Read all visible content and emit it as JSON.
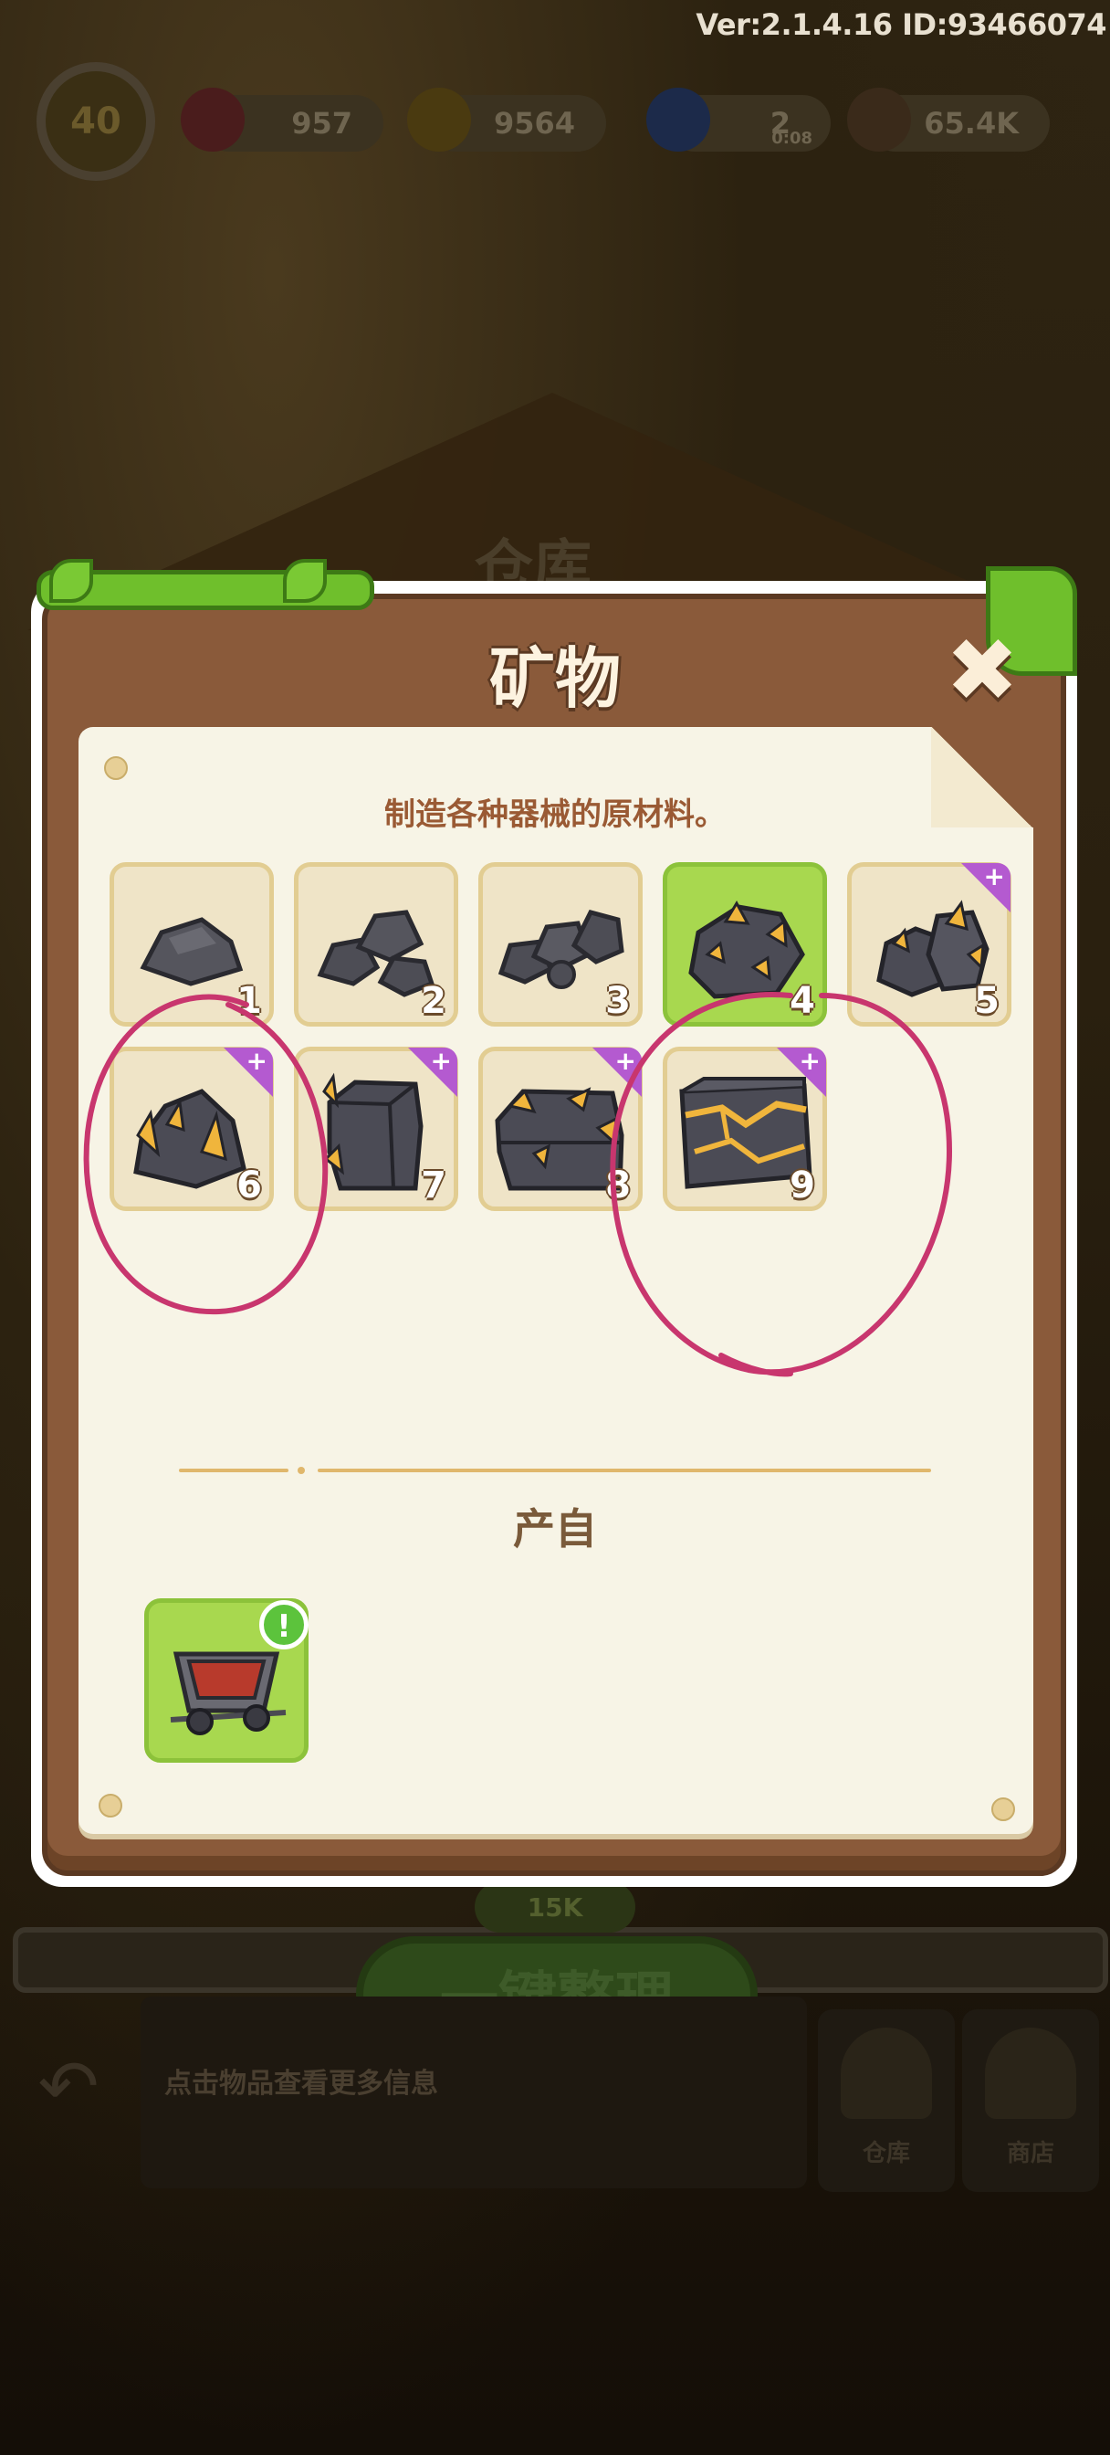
{
  "header": {
    "version": "Ver:2.1.4.16 ID:93466074",
    "level": "40",
    "gems": "957",
    "coins": "9564",
    "energy": "2",
    "energy_timer": "0:08",
    "seeds": "65.4K"
  },
  "background": {
    "warehouse_title": "仓库",
    "coin_cost": "15K",
    "sort_button": "一键整理",
    "hint": "点击物品查看更多信息",
    "nav_warehouse": "仓库",
    "nav_shop": "商店"
  },
  "modal": {
    "title": "矿物",
    "close_icon": "close-icon",
    "subtitle": "制造各种器械的原材料。",
    "items": [
      {
        "level": "1",
        "selected": false,
        "plus": false,
        "icon": "rock-icon"
      },
      {
        "level": "2",
        "selected": false,
        "plus": false,
        "icon": "rock-pile-icon"
      },
      {
        "level": "3",
        "selected": false,
        "plus": false,
        "icon": "rock-cluster-icon"
      },
      {
        "level": "4",
        "selected": true,
        "plus": false,
        "icon": "gold-ore-icon"
      },
      {
        "level": "5",
        "selected": false,
        "plus": true,
        "icon": "gold-ore-stack-icon"
      },
      {
        "level": "6",
        "selected": false,
        "plus": true,
        "icon": "crystal-ore-icon"
      },
      {
        "level": "7",
        "selected": false,
        "plus": true,
        "icon": "ore-block-icon"
      },
      {
        "level": "8",
        "selected": false,
        "plus": true,
        "icon": "ore-block-stack-icon"
      },
      {
        "level": "9",
        "selected": false,
        "plus": true,
        "icon": "gold-vein-block-icon"
      }
    ],
    "source_title": "产自",
    "source_item": {
      "icon": "mine-cart-icon",
      "badge": "!"
    }
  },
  "colors": {
    "frame": "#8a5a3a",
    "paper": "#f7f4e6",
    "selected_slot": "#a8d84f",
    "plus_badge": "#b45ad0",
    "annotation": "#c8366e"
  }
}
